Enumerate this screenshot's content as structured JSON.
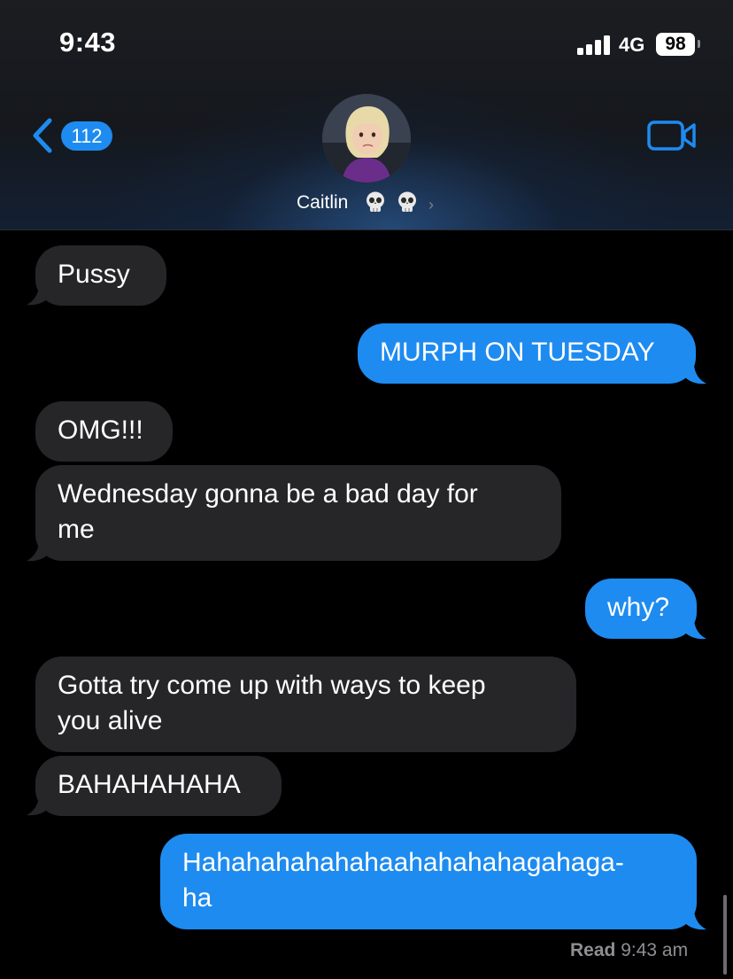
{
  "status_bar": {
    "time": "9:43",
    "network": "4G",
    "battery": "98"
  },
  "header": {
    "back_count": "112",
    "contact_name": "Caitlin",
    "avatar_icon": "contact-photo",
    "video_icon": "video-camera-icon"
  },
  "messages": [
    {
      "direction": "incoming",
      "text": "Pussy"
    },
    {
      "direction": "outgoing",
      "text": "MURPH ON TUESDAY"
    },
    {
      "direction": "incoming",
      "text": "OMG!!!"
    },
    {
      "direction": "incoming",
      "text": "Wednesday gonna be a bad day for\nme"
    },
    {
      "direction": "outgoing",
      "text": "why?"
    },
    {
      "direction": "incoming",
      "text": "Gotta try come up with ways to keep\nyou alive"
    },
    {
      "direction": "incoming",
      "text": "BAHAHAHAHA"
    },
    {
      "direction": "outgoing",
      "text": "Hahahahahahahaahahahahagahaga-\nha"
    }
  ],
  "read_receipt": {
    "label": "Read",
    "time": "9:43 am"
  },
  "colors": {
    "accent": "#1e8bf0",
    "incoming_bubble": "#262629",
    "background": "#000000"
  }
}
